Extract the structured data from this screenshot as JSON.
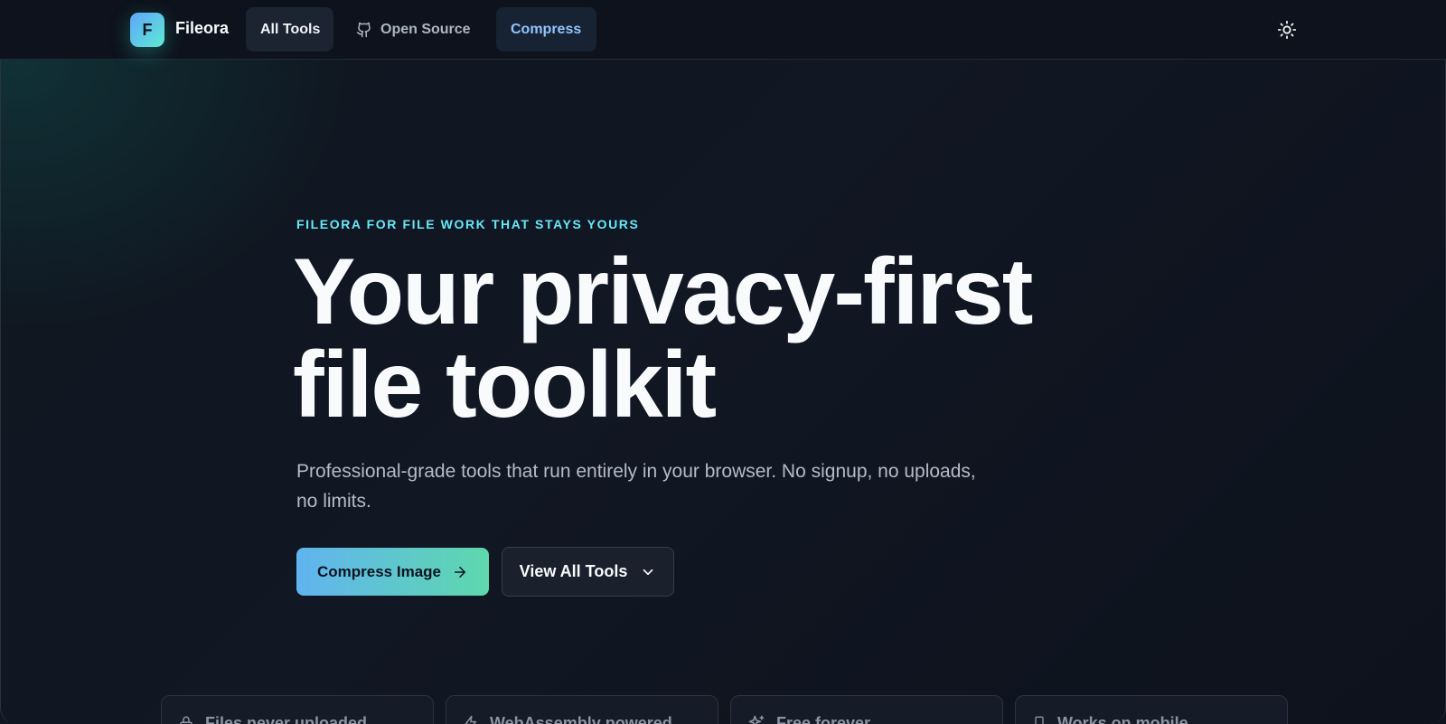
{
  "header": {
    "logo_letter": "F",
    "brand": "Fileora",
    "nav": [
      {
        "label": "All Tools",
        "icon": null
      },
      {
        "label": "Open Source",
        "icon": "github-icon"
      },
      {
        "label": "Compress",
        "icon": null
      }
    ],
    "theme_toggle_icon": "sun-icon"
  },
  "hero": {
    "eyebrow": "FILEORA FOR FILE WORK THAT STAYS YOURS",
    "headline": "Your privacy-first file toolkit",
    "subtitle": "Professional-grade tools that run entirely in your browser. No signup, no uploads, no limits.",
    "primary_cta": {
      "label": "Compress Image",
      "icon": "arrow-right-icon"
    },
    "secondary_cta": {
      "label": "View All Tools",
      "icon": "chevron-down-icon"
    }
  },
  "features": [
    {
      "label": "Files never uploaded",
      "icon": "lock-icon"
    },
    {
      "label": "WebAssembly powered",
      "icon": "zap-icon"
    },
    {
      "label": "Free forever",
      "icon": "sparkles-icon"
    },
    {
      "label": "Works on mobile",
      "icon": "smartphone-icon"
    }
  ],
  "colors": {
    "background": "#0d121c",
    "accent_gradient_start": "#60b4f0",
    "accent_gradient_end": "#5ed8ac",
    "eyebrow": "#67e8f9",
    "active_nav_text": "#93c5fd"
  }
}
